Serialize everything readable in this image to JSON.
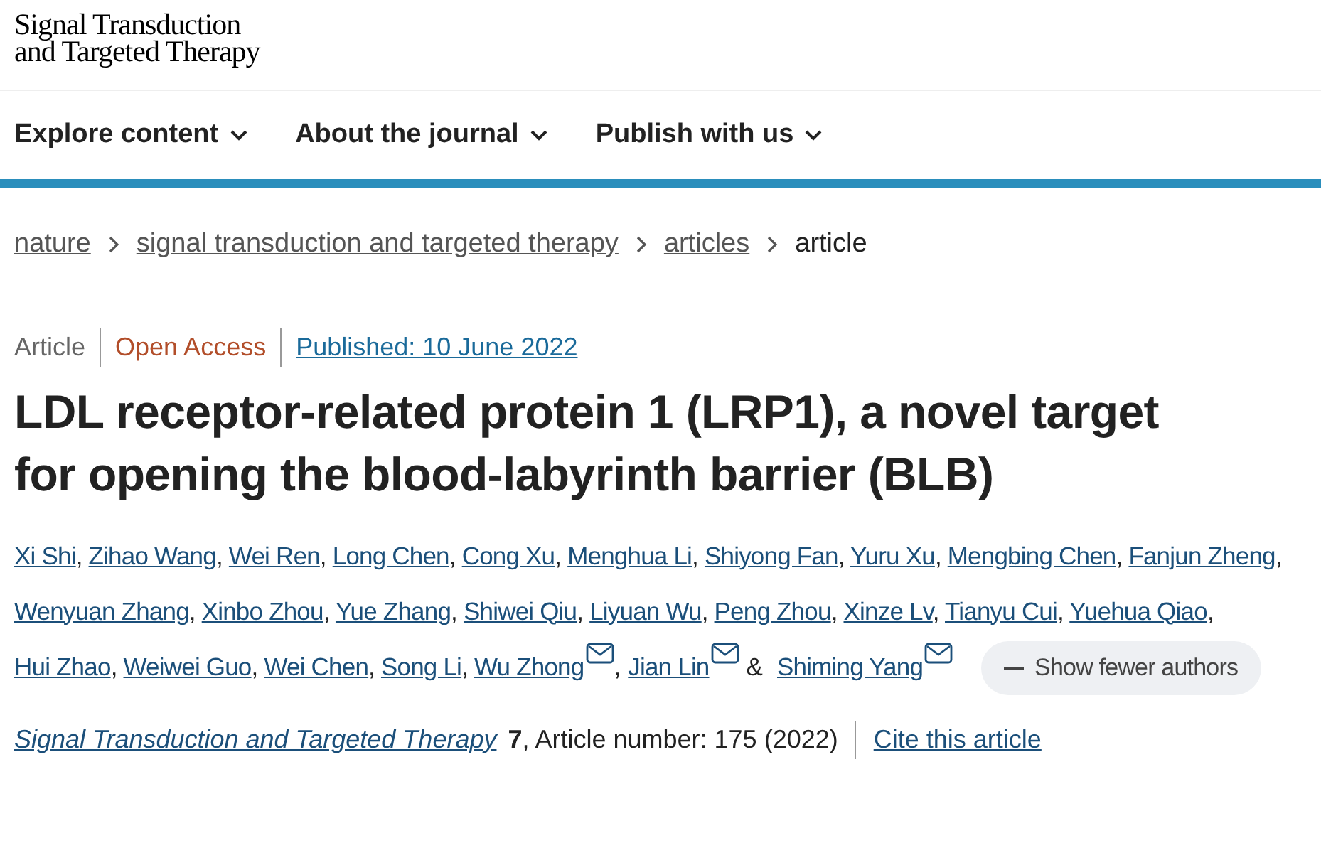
{
  "logo": {
    "lines": [
      "Signal Transduction",
      "and Targeted Therapy"
    ]
  },
  "nav": [
    {
      "label": "Explore content"
    },
    {
      "label": "About the journal"
    },
    {
      "label": "Publish with us"
    }
  ],
  "breadcrumbs": [
    {
      "label": "nature",
      "link": true
    },
    {
      "label": "signal transduction and targeted therapy",
      "link": true
    },
    {
      "label": "articles",
      "link": true
    },
    {
      "label": "article",
      "link": false
    }
  ],
  "meta": {
    "type": "Article",
    "access": "Open Access",
    "published": "Published: 10 June 2022"
  },
  "title": "LDL receptor-related protein 1 (LRP1), a novel target for opening the blood-labyrinth barrier (BLB)",
  "authors": [
    {
      "name": "Xi Shi",
      "corresponding": false,
      "separator": ","
    },
    {
      "name": "Zihao Wang",
      "corresponding": false,
      "separator": ","
    },
    {
      "name": "Wei Ren",
      "corresponding": false,
      "separator": ","
    },
    {
      "name": "Long Chen",
      "corresponding": false,
      "separator": ","
    },
    {
      "name": "Cong Xu",
      "corresponding": false,
      "separator": ","
    },
    {
      "name": "Menghua Li",
      "corresponding": false,
      "separator": ","
    },
    {
      "name": "Shiyong Fan",
      "corresponding": false,
      "separator": ","
    },
    {
      "name": "Yuru Xu",
      "corresponding": false,
      "separator": ","
    },
    {
      "name": "Mengbing Chen",
      "corresponding": false,
      "separator": ","
    },
    {
      "name": "Fanjun Zheng",
      "corresponding": false,
      "separator": ","
    },
    {
      "name": "Wenyuan Zhang",
      "corresponding": false,
      "separator": ","
    },
    {
      "name": "Xinbo Zhou",
      "corresponding": false,
      "separator": ","
    },
    {
      "name": "Yue Zhang",
      "corresponding": false,
      "separator": ","
    },
    {
      "name": "Shiwei Qiu",
      "corresponding": false,
      "separator": ","
    },
    {
      "name": "Liyuan Wu",
      "corresponding": false,
      "separator": ","
    },
    {
      "name": "Peng Zhou",
      "corresponding": false,
      "separator": ","
    },
    {
      "name": "Xinze Lv",
      "corresponding": false,
      "separator": ","
    },
    {
      "name": "Tianyu Cui",
      "corresponding": false,
      "separator": ","
    },
    {
      "name": "Yuehua Qiao",
      "corresponding": false,
      "separator": ","
    },
    {
      "name": "Hui Zhao",
      "corresponding": false,
      "separator": ","
    },
    {
      "name": "Weiwei Guo",
      "corresponding": false,
      "separator": ","
    },
    {
      "name": "Wei Chen",
      "corresponding": false,
      "separator": ","
    },
    {
      "name": "Song Li",
      "corresponding": false,
      "separator": ","
    },
    {
      "name": "Wu Zhong",
      "corresponding": true,
      "separator": ","
    },
    {
      "name": "Jian Lin",
      "corresponding": true,
      "separator": "&"
    },
    {
      "name": "Shiming Yang",
      "corresponding": true
    }
  ],
  "toggle_authors": {
    "label": "Show fewer authors"
  },
  "citation": {
    "journal": "Signal Transduction and Targeted Therapy",
    "volume": "7",
    "article_number": ", Article number: 175 (2022)",
    "cite": "Cite this article"
  }
}
